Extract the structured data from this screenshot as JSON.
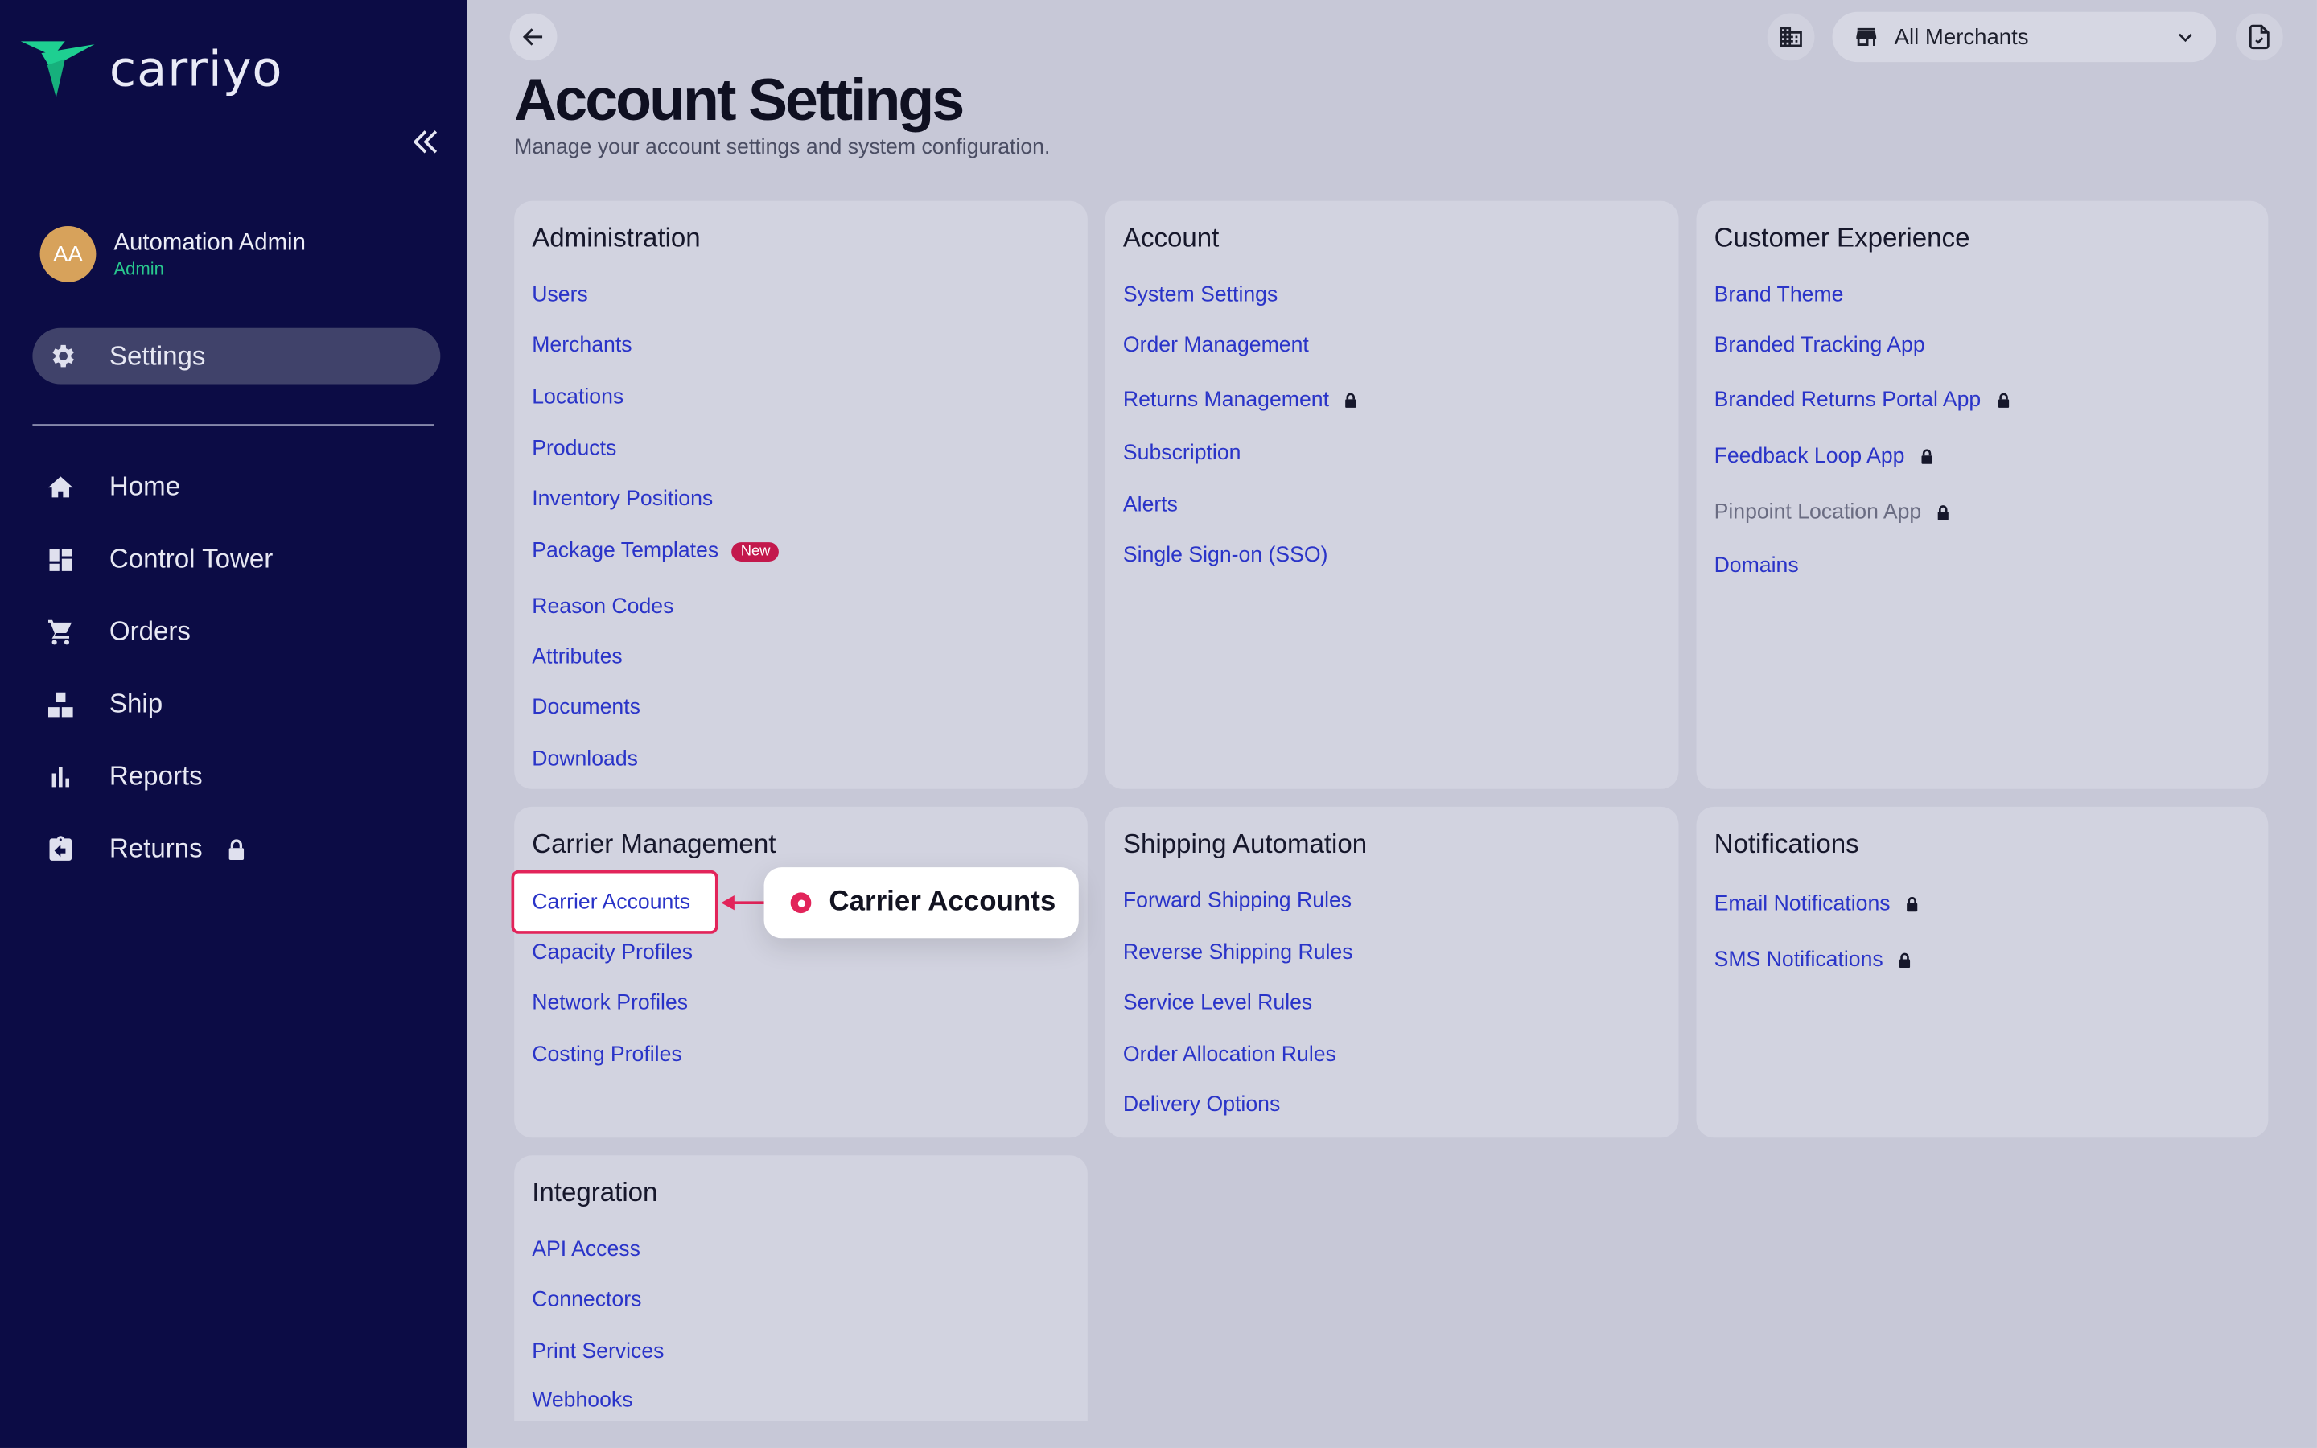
{
  "app": {
    "logo_text": "carriyo"
  },
  "user": {
    "initials": "AA",
    "name": "Automation Admin",
    "role": "Admin"
  },
  "sidebar": {
    "active": {
      "label": "Settings",
      "icon": "gear-icon"
    },
    "items": [
      {
        "label": "Home",
        "icon": "home-icon"
      },
      {
        "label": "Control Tower",
        "icon": "dashboard-icon"
      },
      {
        "label": "Orders",
        "icon": "cart-icon"
      },
      {
        "label": "Ship",
        "icon": "boxes-icon"
      },
      {
        "label": "Reports",
        "icon": "bar-chart-icon"
      },
      {
        "label": "Returns",
        "icon": "returns-icon",
        "locked": true
      }
    ]
  },
  "header": {
    "merchant_select": "All Merchants",
    "title": "Account Settings",
    "subtitle": "Manage your account settings and system configuration."
  },
  "cards": {
    "administration": {
      "title": "Administration",
      "links": [
        "Users",
        "Merchants",
        "Locations",
        "Products",
        "Inventory Positions",
        "Package Templates",
        "Reason Codes",
        "Attributes",
        "Documents",
        "Downloads"
      ],
      "new_badge": "New"
    },
    "account": {
      "title": "Account",
      "links": [
        "System Settings",
        "Order Management",
        "Returns Management",
        "Subscription",
        "Alerts",
        "Single Sign-on (SSO)"
      ]
    },
    "customer_experience": {
      "title": "Customer Experience",
      "links": [
        "Brand Theme",
        "Branded Tracking App",
        "Branded Returns Portal App",
        "Feedback Loop App",
        "Pinpoint Location App",
        "Domains"
      ]
    },
    "carrier_management": {
      "title": "Carrier Management",
      "links": [
        "Carrier Accounts",
        "Capacity Profiles",
        "Network Profiles",
        "Costing Profiles"
      ]
    },
    "shipping_automation": {
      "title": "Shipping Automation",
      "links": [
        "Forward Shipping Rules",
        "Reverse Shipping Rules",
        "Service Level Rules",
        "Order Allocation Rules",
        "Delivery Options"
      ]
    },
    "notifications": {
      "title": "Notifications",
      "links": [
        "Email Notifications",
        "SMS Notifications"
      ]
    },
    "integration": {
      "title": "Integration",
      "links": [
        "API Access",
        "Connectors",
        "Print Services",
        "Webhooks"
      ]
    }
  },
  "callout": {
    "label": "Carrier Accounts"
  },
  "colors": {
    "sidebar_bg": "#0c0c45",
    "accent_green": "#29c78e",
    "link": "#2a34c8",
    "highlight": "#e2245a"
  }
}
